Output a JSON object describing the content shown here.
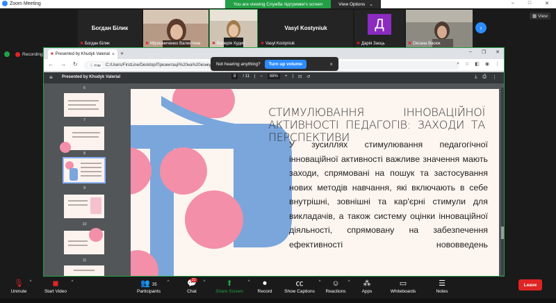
{
  "zoom": {
    "app_title": "Zoom Meeting",
    "viewing_banner": "You are viewing Служба підтримки's screen",
    "view_options": "View Options",
    "window_controls": [
      "–",
      "□",
      "✕"
    ]
  },
  "gallery": {
    "tiles": [
      {
        "big_name": "Богдан Білик",
        "label": "Богдан Білик"
      },
      {
        "big_name": "",
        "label": "Мірошниченко Валентина"
      },
      {
        "big_name": "",
        "label": "Валерія Худик"
      },
      {
        "big_name": "Vasyl Kostyniuk",
        "label": "Vasyl Kostyniuk"
      },
      {
        "big_name": "Д",
        "label": "Дарія Заєць"
      },
      {
        "big_name": "",
        "label": "Оксана Васюк"
      }
    ],
    "view_label": "View"
  },
  "recording_label": "Recording",
  "browser": {
    "tab_title": "Presented by Khudyk Valerial",
    "url": "C:/Users/FirstLine/Desktop/Презентації%20на%20конкурс%202023",
    "url_chip": "File",
    "nav": [
      "←",
      "→",
      "↻"
    ]
  },
  "toast": {
    "message": "Not hearing anything?",
    "button": "Turn up volume"
  },
  "pdf": {
    "title": "Presented by Khudyk Valerial",
    "page_field": "8",
    "page_total": "/ 11",
    "zoom_field": "68%",
    "thumb_numbers": [
      "6",
      "7",
      "8",
      "9",
      "10",
      "11"
    ]
  },
  "slide": {
    "title": "СТИМУЛЮВАННЯ ІННОВАЦІЙНОЇ АКТИВНОСТІ ПЕДАГОГІВ: ЗАХОДИ ТА ПЕРСПЕКТИВИ",
    "body": "У зусиллях стимулювання педагогічної інноваційної активності важливе значення мають заходи, спрямовані на пошук та застосування нових методів навчання, які включають в себе внутрішні, зовнішні та кар'єрні стимули для викладачів, а також систему оцінки інноваційної діяльності, спрямовану на забезпечення ефективності нововведень"
  },
  "controls": {
    "unmute": "Unmute",
    "start_video": "Start Video",
    "participants": "Participants",
    "participants_count": "35",
    "chat": "Chat",
    "chat_badge": "21",
    "share_screen": "Share Screen",
    "record": "Record",
    "show_captions": "Show Captions",
    "reactions": "Reactions",
    "apps": "Apps",
    "whiteboards": "Whiteboards",
    "notes": "Notes",
    "leave": "Leave"
  },
  "colors": {
    "zoom_blue": "#2d8cff",
    "share_green": "#23a045",
    "leave_red": "#e02424",
    "slide_pink": "#f38fa8",
    "slide_blue": "#7aa6dc"
  }
}
